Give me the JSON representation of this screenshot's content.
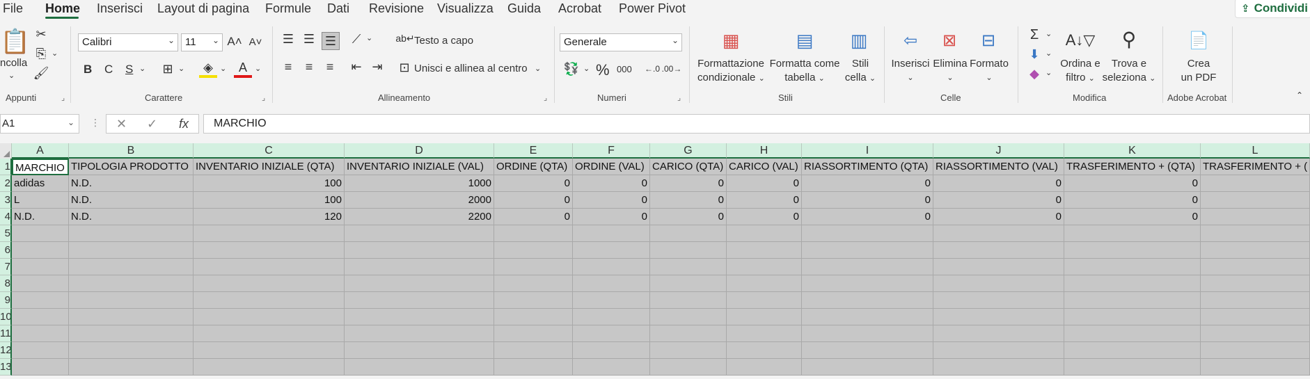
{
  "menu": {
    "items": [
      "File",
      "Home",
      "Inserisci",
      "Layout di pagina",
      "Formule",
      "Dati",
      "Revisione",
      "Visualizza",
      "Guida",
      "Acrobat",
      "Power Pivot"
    ],
    "active": "Home",
    "share_label": "Condividi"
  },
  "ribbon": {
    "clipboard": {
      "paste_label": "ncolla",
      "group_label": "Appunti"
    },
    "font": {
      "font_name": "Calibri",
      "font_size": "11",
      "bold": "B",
      "italic": "C",
      "underline": "S",
      "group_label": "Carattere"
    },
    "alignment": {
      "wrap_text": "Testo a capo",
      "merge_center": "Unisci e allinea al centro",
      "group_label": "Allineamento"
    },
    "number": {
      "format": "Generale",
      "percent": "%",
      "thousands": "000",
      "group_label": "Numeri"
    },
    "styles": {
      "conditional_formatting": [
        "Formattazione",
        "condizionale"
      ],
      "format_as_table": [
        "Formatta come",
        "tabella"
      ],
      "cell_styles": [
        "Stili",
        "cella"
      ],
      "group_label": "Stili"
    },
    "cells": {
      "insert": "Inserisci",
      "delete": "Elimina",
      "format": "Formato",
      "group_label": "Celle"
    },
    "editing": {
      "sort_filter": [
        "Ordina e",
        "filtro"
      ],
      "find_select": [
        "Trova e",
        "seleziona"
      ],
      "group_label": "Modifica"
    },
    "acrobat": {
      "create_pdf": [
        "Crea",
        "un PDF"
      ],
      "group_label": "Adobe Acrobat"
    }
  },
  "formula_bar": {
    "name_box": "A1",
    "fx": "fx",
    "content": "MARCHIO"
  },
  "grid": {
    "columns": [
      "A",
      "B",
      "C",
      "D",
      "E",
      "F",
      "G",
      "H",
      "I",
      "J",
      "K",
      "L"
    ],
    "row_numbers": [
      "1",
      "2",
      "3",
      "4",
      "5",
      "6",
      "7",
      "8",
      "9",
      "10",
      "11",
      "12",
      "13"
    ],
    "header_row": [
      "MARCHIO",
      "TIPOLOGIA PRODOTTO",
      "INVENTARIO INIZIALE (QTA)",
      "INVENTARIO INIZIALE (VAL)",
      "ORDINE (QTA)",
      "ORDINE (VAL)",
      "CARICO (QTA)",
      "CARICO (VAL)",
      "RIASSORTIMENTO (QTA)",
      "RIASSORTIMENTO (VAL)",
      "TRASFERIMENTO + (QTA)",
      "TRASFERIMENTO + ("
    ],
    "data_rows": [
      [
        "adidas",
        "N.D.",
        "100",
        "1000",
        "0",
        "0",
        "0",
        "0",
        "0",
        "0",
        "0",
        ""
      ],
      [
        "L",
        "N.D.",
        "100",
        "2000",
        "0",
        "0",
        "0",
        "0",
        "0",
        "0",
        "0",
        ""
      ],
      [
        "N.D.",
        "N.D.",
        "120",
        "2200",
        "0",
        "0",
        "0",
        "0",
        "0",
        "0",
        "0",
        ""
      ]
    ]
  },
  "colors": {
    "accent": "#1e6e3f",
    "header_fill": "#d3f0e0",
    "cell_fill": "#c7c7c7"
  }
}
